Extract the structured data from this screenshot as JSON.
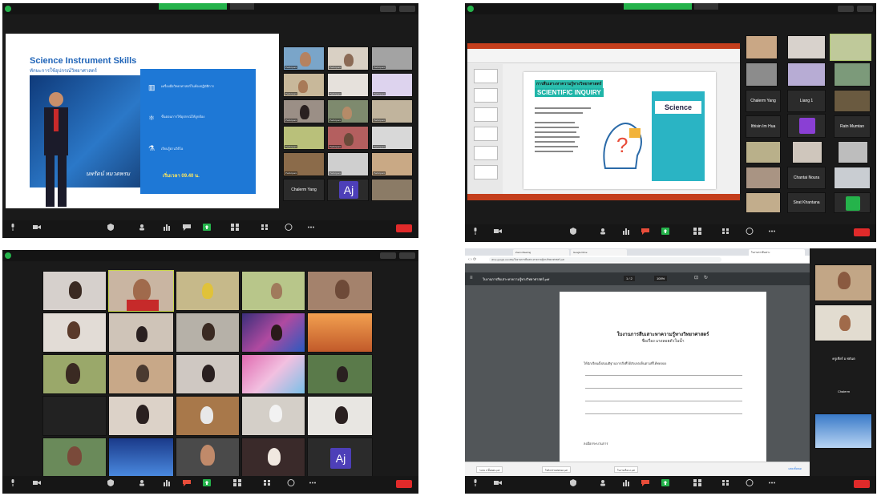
{
  "colors": {
    "zoom_bg": "#1a1a1a",
    "share_green": "#24b24b",
    "end_red": "#e02a2a",
    "slide_blue": "#1f64b8",
    "powerpoint_red": "#c43e1c",
    "teal": "#1fb5a8",
    "avatar_purple": "#4d3fb8"
  },
  "shot1": {
    "slide": {
      "title": "Science Instrument Skills",
      "subtitle": "ทักษะการใช้อุปกรณ์วิทยาศาสตร์",
      "bullets": [
        "เครื่องมือวิทยาศาสตร์ในห้องปฏิบัติการ",
        "ขั้นตอนการใช้อุปกรณ์ให้ถูกต้อง",
        "เรียนรู้ผ่านวิดีโอ"
      ],
      "time": "เริ่มเวลา 09.40 น.",
      "signature": "นพรัตน์ หมวดพรม"
    },
    "tiles": [
      {
        "name": "Participant"
      },
      {
        "name": "Participant"
      },
      {
        "name": "Participant"
      },
      {
        "name": "Participant"
      },
      {
        "name": "Participant"
      },
      {
        "name": "Participant"
      },
      {
        "name": "Participant"
      },
      {
        "name": "Participant"
      },
      {
        "name": "Participant"
      },
      {
        "name": "Participant"
      },
      {
        "name": "Participant"
      },
      {
        "name": "Participant"
      },
      {
        "name": "Participant"
      },
      {
        "name": "Participant"
      },
      {
        "name": "Participant"
      }
    ],
    "name_tile": "Chalerm Yang",
    "avatar": "Aj"
  },
  "shot2": {
    "ppt_title1": "การสืบเสาะหาความรู้ทางวิทยาศาสตร์",
    "ppt_title2": "SCIENTIFIC INQUIRY",
    "science_word": "Science",
    "name_tiles": [
      "Chalerm Yang",
      "Liang 1",
      "Ithisin Im Hua",
      "Ratn Mumtan",
      "Chantai Noura",
      "Sirat Khantana"
    ]
  },
  "shot3": {
    "avatar": "Aj"
  },
  "shot4": {
    "tabs": [
      "Zoom Meeting",
      "Google Drive",
      "ใบงานการสืบเสาะ"
    ],
    "url": "drive.google.com/file/ใบงานการสืบเสาะหาความรู้ทางวิทยาศาสตร์.pdf",
    "pdf_name": "ใบงานการสืบเสาะหาความรู้ทางวิทยาศาสตร์.pdf",
    "page_info": "1 / 2",
    "zoom_info": "100%",
    "doc_title": "ใบงานการสืบเสาะหาความรู้ทางวิทยาศาสตร์",
    "doc_subtitle": "ชื่อเรื่อง แรงลอยตัวในน้ำ",
    "question1": "ให้นักเรียนตั้งสมมติฐานจากสิ่งที่ได้สังเกตเห็นตามที่ได้ทดลอง",
    "question2": "ลงมือกระบวนการ",
    "downloads": [
      "ระบบ 3 ขั้นตอน.pdf",
      "ใบกิจกรรมทดลอง.pdf",
      "ใบงานเรื่อง 2.pdf"
    ],
    "show_all": "แสดงทั้งหมด",
    "side_labels": [
      "ครูเชียร์ อ.ชยันต",
      "Chalerm"
    ]
  }
}
